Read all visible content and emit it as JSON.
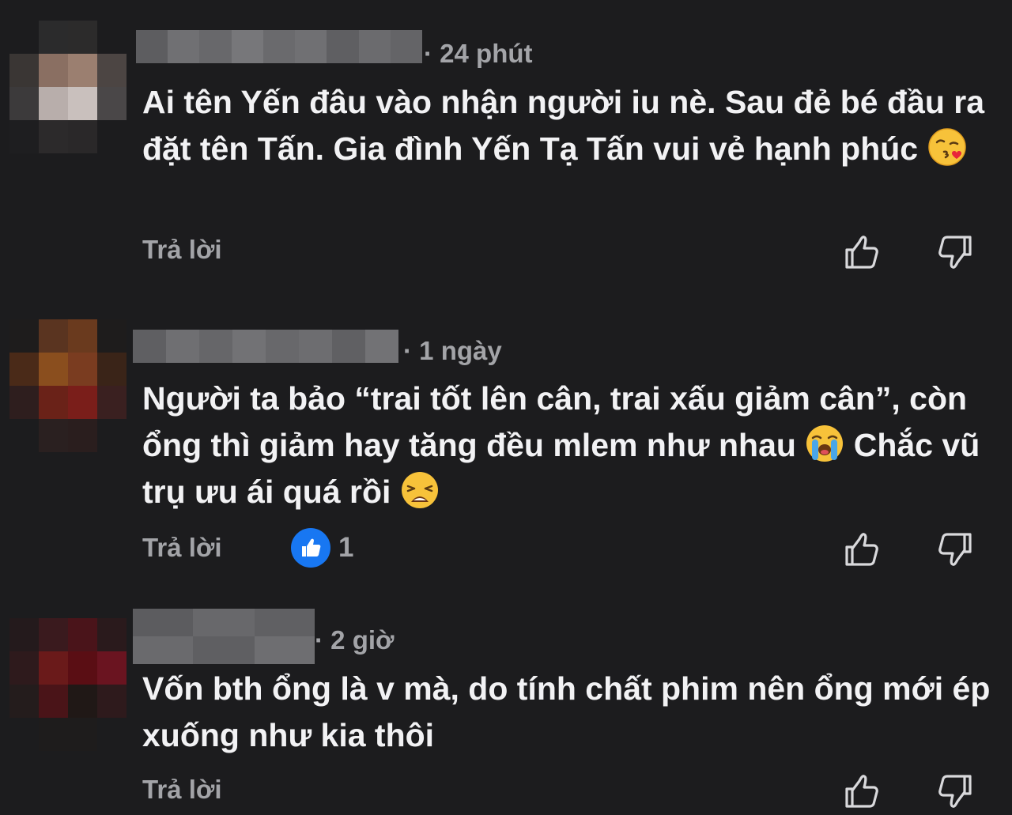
{
  "comments": [
    {
      "time": "24 phút",
      "text": "Ai tên Yến đâu vào nhận người iu nè. Sau đẻ bé đầu ra đặt tên Tấn. Gia đình Yến Tạ Tấn vui vẻ hạnh phúc",
      "reply_label": "Trả lời",
      "trailing_emoji": "kissing-heart-emoji"
    },
    {
      "time": "1 ngày",
      "text_before": "Người ta bảo “trai tốt lên cân, trai xấu giảm cân”, còn ổng thì giảm hay tăng đều mlem như nhau",
      "text_after": "Chắc vũ trụ ưu ái quá rồi",
      "reply_label": "Trả lời",
      "like_count": "1",
      "emojis": [
        "loudly-crying-emoji",
        "weary-face-emoji"
      ]
    },
    {
      "time": "2 giờ",
      "text": "Vốn bth ổng là v mà, do tính chất phim nên ổng mới ép xuống như kia thôi",
      "reply_label": "Trả lời"
    }
  ],
  "icons": {
    "like": "thumbs-up-outline-icon",
    "dislike": "thumbs-down-outline-icon",
    "reaction": "like-reaction-icon"
  },
  "colors": {
    "background": "#1c1c1e",
    "text": "#f2f2f4",
    "secondary": "#a3a4a8",
    "accent": "#1877f2"
  }
}
